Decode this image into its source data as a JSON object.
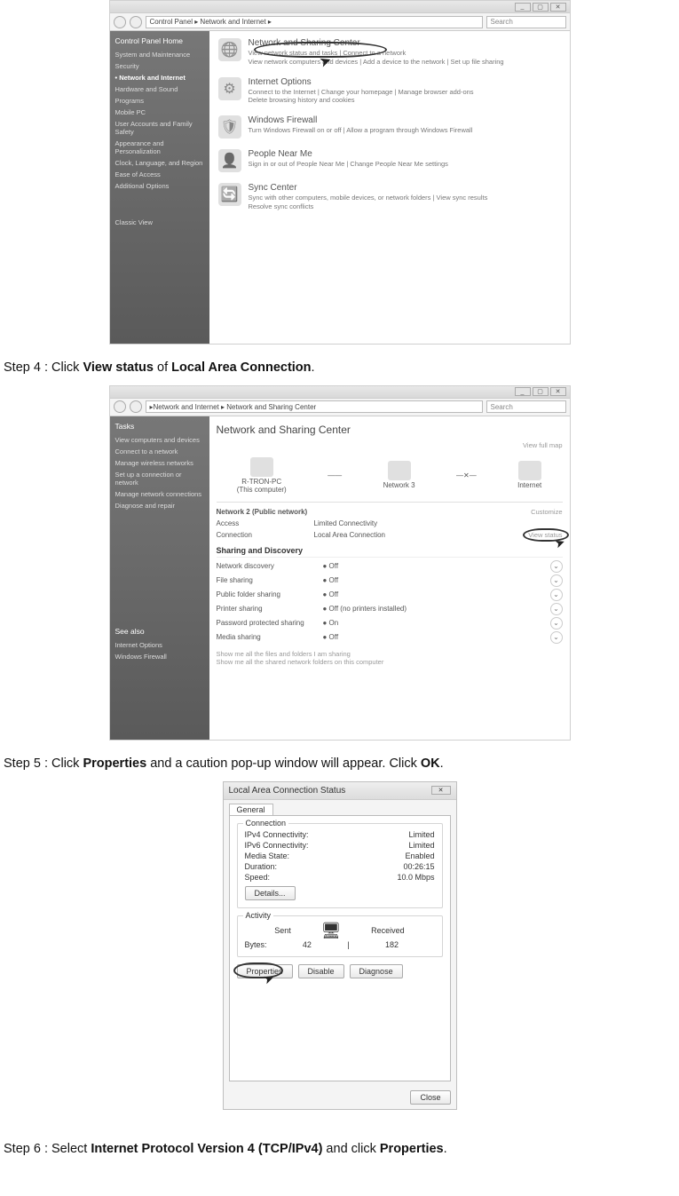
{
  "step4": {
    "prefix": "Step 4 : Click ",
    "b1": "View status",
    "mid": " of ",
    "b2": "Local Area Connection",
    "suffix": "."
  },
  "step5": {
    "prefix": "Step 5 : Click ",
    "b1": "Properties",
    "mid": " and a caution pop-up window will appear. Click ",
    "b2": "OK",
    "suffix": "."
  },
  "step6": {
    "prefix": "Step 6 : Select ",
    "b1": "Internet Protocol Version 4 (TCP/IPv4)",
    "mid": " and click ",
    "b2": "Properties",
    "suffix": "."
  },
  "fig1": {
    "breadcrumb": "Control Panel  ▸  Network and Internet  ▸",
    "search_placeholder": "Search",
    "sidebar": {
      "header": "Control Panel Home",
      "items": [
        "System and Maintenance",
        "Security",
        "Network and Internet",
        "Hardware and Sound",
        "Programs",
        "Mobile PC",
        "User Accounts and Family Safety",
        "Appearance and Personalization",
        "Clock, Language, and Region",
        "Ease of Access",
        "Additional Options"
      ],
      "active_index": 2,
      "footer": "Classic View"
    },
    "categories": [
      {
        "icon": "🌐",
        "title": "Network and Sharing Center",
        "sub": "View network status and tasks   |   Connect to a network\nView network computers and devices   |   Add a device to the network   |   Set up file sharing"
      },
      {
        "icon": "⚙",
        "title": "Internet Options",
        "sub": "Connect to the Internet   |   Change your homepage   |   Manage browser add-ons\nDelete browsing history and cookies"
      },
      {
        "icon": "🛡",
        "title": "Windows Firewall",
        "sub": "Turn Windows Firewall on or off   |   Allow a program through Windows Firewall"
      },
      {
        "icon": "👤",
        "title": "People Near Me",
        "sub": "Sign in or out of People Near Me   |   Change People Near Me settings"
      },
      {
        "icon": "🔄",
        "title": "Sync Center",
        "sub": "Sync with other computers, mobile devices, or network folders   |   View sync results\nResolve sync conflicts"
      }
    ]
  },
  "fig2": {
    "breadcrumb": "Network and Internet  ▸  Network and Sharing Center",
    "search_placeholder": "Search",
    "heading": "Network and Sharing Center",
    "view_full_map": "View full map",
    "sidebar": {
      "header": "Tasks",
      "items": [
        "View computers and devices",
        "Connect to a network",
        "Manage wireless networks",
        "Set up a connection or network",
        "Manage network connections",
        "Diagnose and repair"
      ],
      "see_also_header": "See also",
      "see_also": [
        "Internet Options",
        "Windows Firewall"
      ]
    },
    "nodes": {
      "pc": "R-TRON-PC\n(This computer)",
      "net": "Network  3",
      "internet": "Internet"
    },
    "network_line": {
      "label": "Network 2 (Public network)",
      "customize": "Customize"
    },
    "access": {
      "k": "Access",
      "v": "Limited Connectivity"
    },
    "connection": {
      "k": "Connection",
      "v": "Local Area Connection",
      "link": "View status"
    },
    "sharing_header": "Sharing and Discovery",
    "sharing": [
      {
        "k": "Network discovery",
        "v": "● Off"
      },
      {
        "k": "File sharing",
        "v": "● Off"
      },
      {
        "k": "Public folder sharing",
        "v": "● Off"
      },
      {
        "k": "Printer sharing",
        "v": "● Off (no printers installed)"
      },
      {
        "k": "Password protected sharing",
        "v": "● On"
      },
      {
        "k": "Media sharing",
        "v": "● Off"
      }
    ],
    "footer_links": [
      "Show me all the files and folders I am sharing",
      "Show me all the shared network folders on this computer"
    ]
  },
  "fig3": {
    "title": "Local Area Connection Status",
    "tab": "General",
    "conn_legend": "Connection",
    "conn": {
      "ipv4": {
        "k": "IPv4 Connectivity:",
        "v": "Limited"
      },
      "ipv6": {
        "k": "IPv6 Connectivity:",
        "v": "Limited"
      },
      "media": {
        "k": "Media State:",
        "v": "Enabled"
      },
      "duration": {
        "k": "Duration:",
        "v": "00:26:15"
      },
      "speed": {
        "k": "Speed:",
        "v": "10.0 Mbps"
      }
    },
    "details_btn": "Details...",
    "activity_legend": "Activity",
    "activity": {
      "sent_label": "Sent",
      "recv_label": "Received",
      "bytes_label": "Bytes:",
      "sent": "42",
      "recv": "182"
    },
    "buttons": {
      "properties": "Properties",
      "disable": "Disable",
      "diagnose": "Diagnose",
      "close": "Close"
    }
  }
}
